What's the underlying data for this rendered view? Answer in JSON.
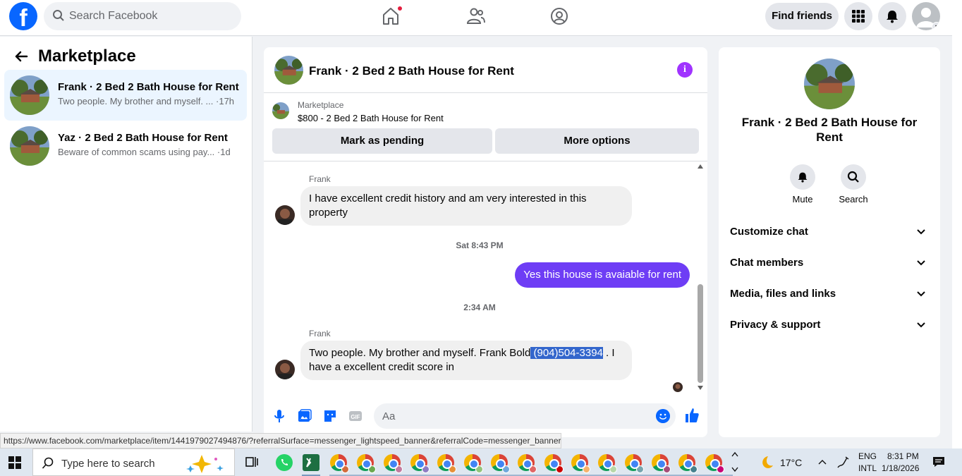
{
  "topbar": {
    "logo": "f",
    "search_placeholder": "Search Facebook",
    "find_friends": "Find friends"
  },
  "sidebar": {
    "title": "Marketplace",
    "conversations": [
      {
        "name": "Frank · 2 Bed 2 Bath House for Rent",
        "snippet": "Two people. My brother and myself. ...",
        "time": "·17h"
      },
      {
        "name": "Yaz · 2 Bed 2 Bath House for Rent",
        "snippet": "Beware of common scams using pay...",
        "time": "·1d"
      }
    ]
  },
  "chat": {
    "title": "Frank · 2 Bed 2 Bath House for Rent",
    "info_glyph": "i",
    "marketplace_label": "Marketplace",
    "listing": "$800 - 2 Bed 2 Bath House for Rent",
    "mark_pending": "Mark as pending",
    "more_options": "More options",
    "messages": {
      "m1_sender": "Frank",
      "m1_text": "I have excellent credit history and am very interested in this property",
      "t1": "Sat 8:43 PM",
      "m2_text": "Yes this house is avaiable for rent",
      "t2": "2:34 AM",
      "m3_sender": "Frank",
      "m3_text_a": "Two people. My brother and myself. Frank Bold",
      "m3_highlight": " (904)504-3394",
      "m3_text_b": " . I have a excellent credit score in"
    },
    "composer_placeholder": "Aa"
  },
  "info_panel": {
    "name": "Frank · 2 Bed 2 Bath House for Rent",
    "mute": "Mute",
    "search": "Search",
    "rows": [
      "Customize chat",
      "Chat members",
      "Media, files and links",
      "Privacy & support"
    ]
  },
  "status_url": "https://www.facebook.com/marketplace/item/1441979027494876/?referralSurface=messenger_lightspeed_banner&referralCode=messenger_banner",
  "taskbar": {
    "search_placeholder": "Type here to search",
    "temp": "17°C",
    "lang1": "ENG",
    "lang2": "INTL",
    "time": "8:31 PM",
    "date": "1/18/2026"
  }
}
